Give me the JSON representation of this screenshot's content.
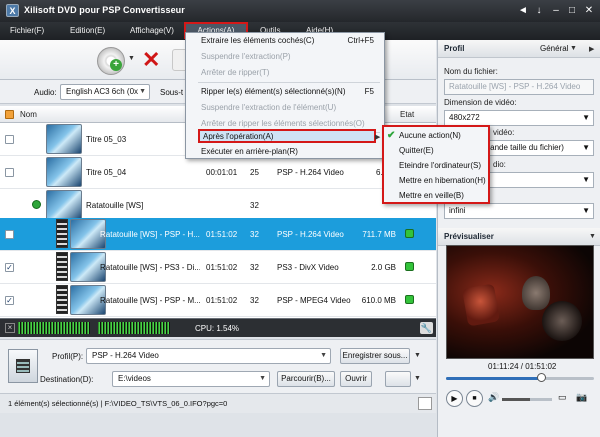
{
  "window": {
    "title": "Xilisoft DVD pour PSP Convertisseur",
    "app_icon_letter": "X",
    "controls": [
      "◄",
      "↓",
      "–",
      "□",
      "✕"
    ]
  },
  "menubar": {
    "items": [
      "Fichier(F)",
      "Edition(E)",
      "Affichage(V)",
      "Actions(A)",
      "Outils",
      "Aide(H)"
    ]
  },
  "actions_menu": {
    "items": [
      {
        "label": "Extraire les éléments cochés(C)",
        "shortcut": "Ctrl+F5",
        "enabled": true
      },
      {
        "label": "Suspendre l'extraction(P)",
        "shortcut": "",
        "enabled": false
      },
      {
        "label": "Arrêter de ripper(T)",
        "shortcut": "",
        "enabled": false
      },
      {
        "label": "Ripper le(s) élément(s) sélectionné(s)(N)",
        "shortcut": "F5",
        "enabled": true
      },
      {
        "label": "Suspendre l'extraction de l'élément(U)",
        "shortcut": "",
        "enabled": false
      },
      {
        "label": "Arrêter de ripper les éléments sélectionnés(O)",
        "shortcut": "",
        "enabled": false
      },
      {
        "label": "Après l'opération(A)",
        "shortcut": "",
        "enabled": true
      },
      {
        "label": "Exécuter en arrière-plan(R)",
        "shortcut": "",
        "enabled": true
      }
    ]
  },
  "after_submenu": {
    "items": [
      "Aucune action(N)",
      "Quitter(E)",
      "Eteindre l'ordinateur(S)",
      "Mettre en hibernation(H)",
      "Mettre en veille(B)"
    ],
    "checked_index": 0
  },
  "audio": {
    "label": "Audio:",
    "value": "English AC3 6ch (0x",
    "subtitle_label": "Sous-t"
  },
  "list_header": {
    "name": "Nom",
    "state": "Etat"
  },
  "rows": [
    {
      "name": "Titre 05_03",
      "duration": "",
      "chapters": "",
      "profile": "",
      "size": "",
      "checked": false,
      "selected": false,
      "kind": "title"
    },
    {
      "name": "Titre 05_04",
      "duration": "00:01:01",
      "chapters": "25",
      "profile": "PSP - H.264 Video",
      "size": "6.6 M",
      "checked": false,
      "selected": false,
      "kind": "title"
    },
    {
      "name": "Ratatouille [WS]",
      "duration": "",
      "chapters": "32",
      "profile": "",
      "size": "",
      "checked": false,
      "selected": false,
      "kind": "group"
    },
    {
      "name": "Ratatouille [WS] - PSP - H....",
      "duration": "01:51:02",
      "chapters": "32",
      "profile": "PSP - H.264 Video",
      "size": "711.7 MB",
      "checked": false,
      "selected": true,
      "kind": "child"
    },
    {
      "name": "Ratatouille [WS] - PS3 - Di...",
      "duration": "01:51:02",
      "chapters": "32",
      "profile": "PS3 - DivX Video",
      "size": "2.0 GB",
      "checked": true,
      "selected": false,
      "kind": "child"
    },
    {
      "name": "Ratatouille [WS] - PSP - M...",
      "duration": "01:51:02",
      "chapters": "32",
      "profile": "PSP - MPEG4 Video",
      "size": "610.0 MB",
      "checked": true,
      "selected": false,
      "kind": "child"
    }
  ],
  "cpu": {
    "text": "CPU: 1.54%"
  },
  "bottom": {
    "profile_label": "Profil(P):",
    "profile_value": "PSP - H.264 Video",
    "save_as": "Enregistrer sous...",
    "destination_label": "Destination(D):",
    "destination_value": "E:\\videos",
    "browse": "Parcourir(B)...",
    "open": "Ouvrir"
  },
  "status": {
    "text": "1 élément(s) sélectionné(s) | F:\\VIDEO_TS\\VTS_06_0.IFO?pgc=0"
  },
  "profile_panel": {
    "title": "Profil",
    "mode": "Général",
    "filename_label": "Nom du fichier:",
    "filename_value": "Ratatouille [WS] - PSP - H.264 Video",
    "video_dim_label": "Dimension de vidéo:",
    "video_dim_value": "480x272",
    "quality_label_fragment": "vidéo:",
    "quality_value_fragment": "grande taille du fichier)",
    "audio_label_fragment": "dio:",
    "last_value": "infini"
  },
  "preview": {
    "title": "Prévisualiser",
    "time": "01:11:24 / 01:51:02",
    "progress": 0.64,
    "volume": 0.55
  }
}
